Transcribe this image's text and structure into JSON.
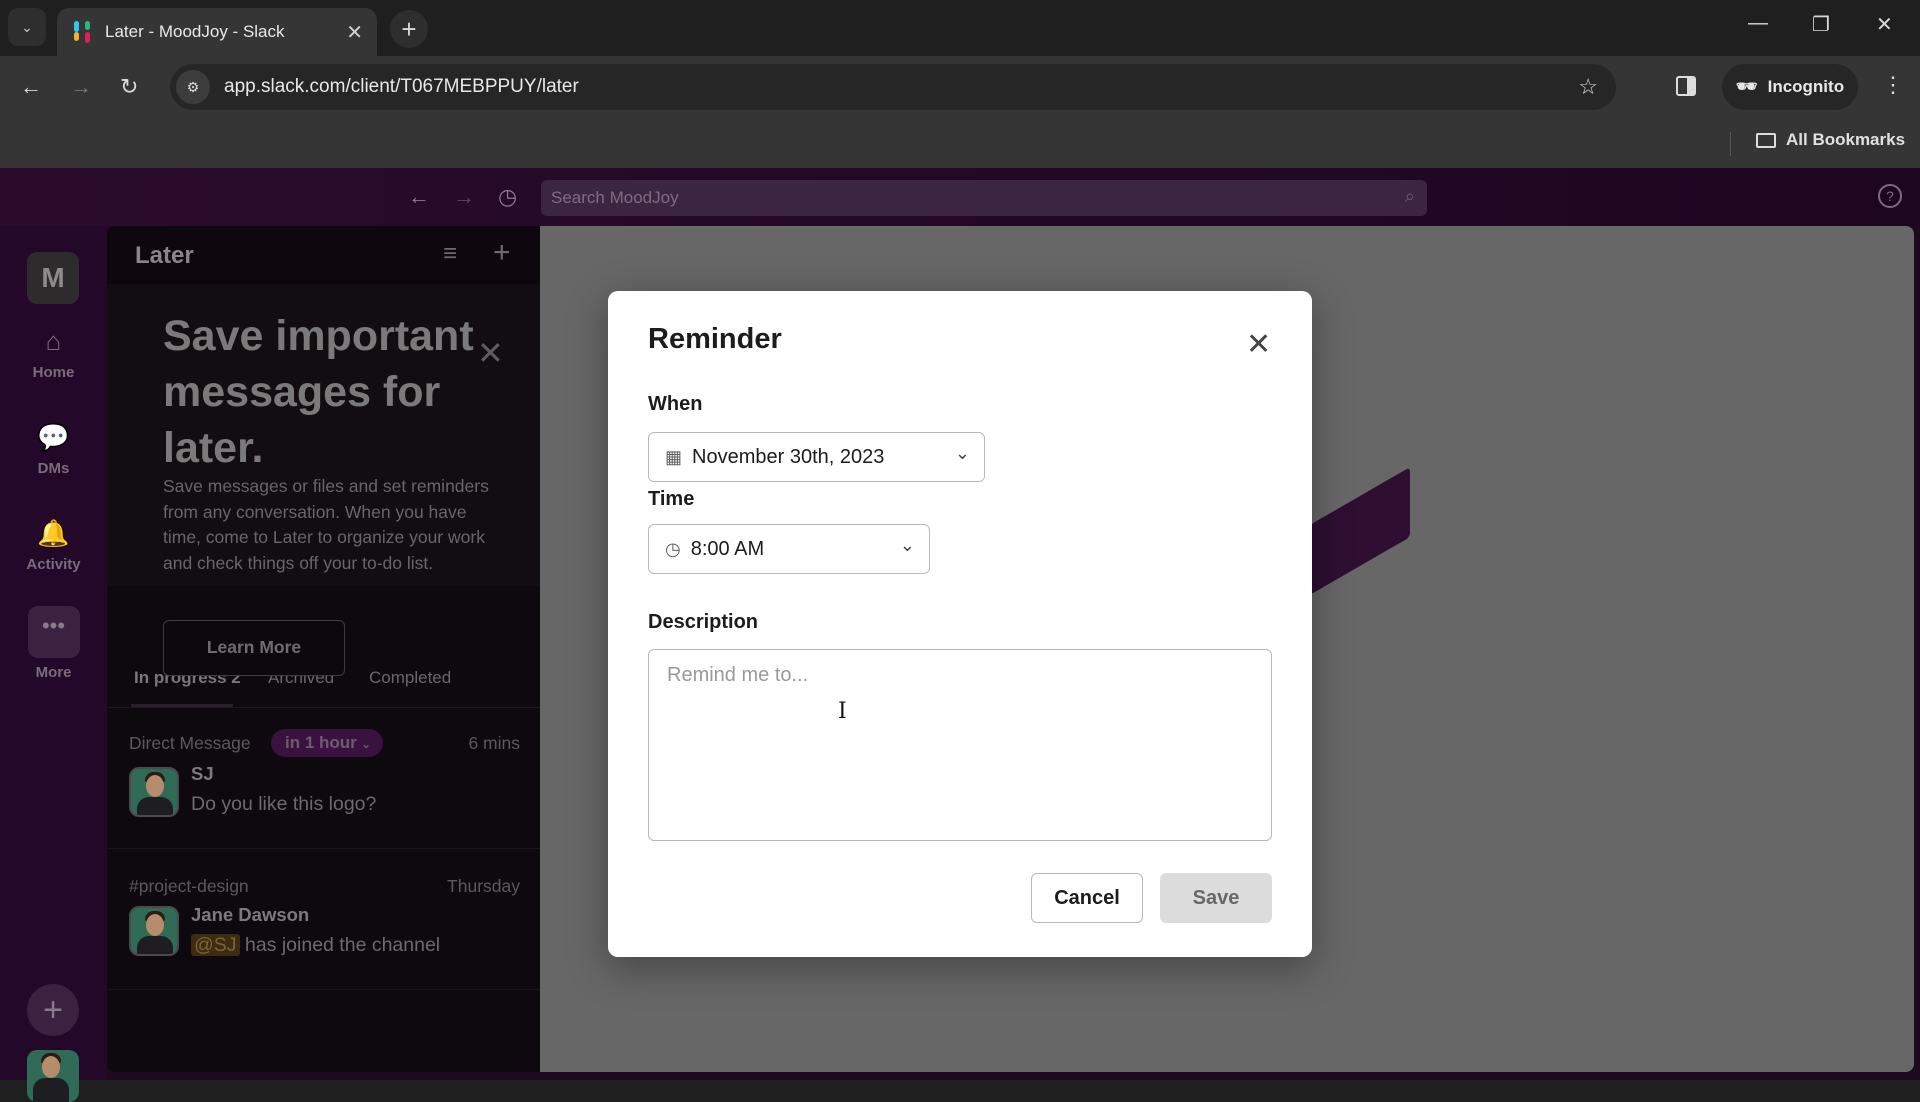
{
  "browser": {
    "tab_title": "Later - MoodJoy - Slack",
    "url": "app.slack.com/client/T067MEBPPUY/later",
    "incognito_label": "Incognito",
    "bookmarks_label": "All Bookmarks",
    "icons": [
      "tab-search-icon",
      "slack-favicon",
      "close-icon",
      "plus-icon",
      "back-icon",
      "forward-icon",
      "reload-icon",
      "site-info-icon",
      "star-icon",
      "side-panel-icon",
      "incognito-icon",
      "kebab-icon",
      "folder-icon",
      "minimize-icon",
      "restore-icon",
      "close-window-icon"
    ]
  },
  "slack_header": {
    "search_placeholder": "Search MoodJoy",
    "help_glyph": "?"
  },
  "rail": {
    "workspace_initial": "M",
    "items": [
      {
        "label": "Home",
        "icon": "home-icon"
      },
      {
        "label": "DMs",
        "icon": "dms-icon"
      },
      {
        "label": "Activity",
        "icon": "bell-icon"
      },
      {
        "label": "More",
        "icon": "more-icon"
      }
    ]
  },
  "later_panel": {
    "title": "Later",
    "promo": {
      "heading": "Save important messages for later.",
      "body": "Save messages or files and set reminders from any conversation. When you have time, come to Later to organize your work and check things off your to-do list.",
      "button": "Learn More"
    },
    "tabs": [
      {
        "label": "In progress 2",
        "active": true
      },
      {
        "label": "Archived",
        "active": false
      },
      {
        "label": "Completed",
        "active": false
      }
    ],
    "items": [
      {
        "source": "Direct Message",
        "reminder": "in 1 hour",
        "time": "6 mins",
        "author": "SJ",
        "message": "Do you like this logo?"
      },
      {
        "source": "#project-design",
        "reminder": "",
        "time": "Thursday",
        "author": "Jane Dawson",
        "mention": "@SJ",
        "message": "has joined the channel"
      }
    ]
  },
  "modal": {
    "title": "Reminder",
    "when_label": "When",
    "date_value": "November 30th, 2023",
    "time_label": "Time",
    "time_value": "8:00 AM",
    "description_label": "Description",
    "description_placeholder": "Remind me to...",
    "description_value": "",
    "cancel_label": "Cancel",
    "save_label": "Save"
  }
}
